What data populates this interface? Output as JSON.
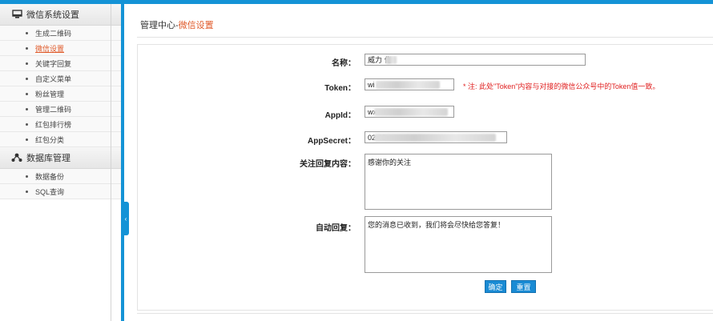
{
  "sidebar": {
    "groups": [
      {
        "title": "微信系统设置",
        "icon": "monitor-icon",
        "items": [
          {
            "label": "生成二维码"
          },
          {
            "label": "微信设置",
            "active": true
          },
          {
            "label": "关键字回复"
          },
          {
            "label": "自定义菜单"
          },
          {
            "label": "粉丝管理"
          },
          {
            "label": "管理二维码"
          },
          {
            "label": "红包排行榜"
          },
          {
            "label": "红包分类"
          }
        ]
      },
      {
        "title": "数据库管理",
        "icon": "network-icon",
        "items": [
          {
            "label": "数据备份"
          },
          {
            "label": "SQL查询"
          }
        ]
      }
    ]
  },
  "breadcrumb": {
    "home": "管理中心-",
    "current": "微信设置"
  },
  "form": {
    "name": {
      "label": "名称：",
      "value": "威力 化"
    },
    "token": {
      "label": "Token：",
      "value": "wi c",
      "note": "* 注: 此处\"Token\"内容与对接的微信公众号中的Token值一致。"
    },
    "appid": {
      "label": "AppId：",
      "value": "wx"
    },
    "appsecret": {
      "label": "AppSecret：",
      "value": "02 42"
    },
    "follow_reply": {
      "label": "关注回复内容：",
      "value": "感谢你的关注"
    },
    "auto_reply": {
      "label": "自动回复：",
      "value": "您的消息已收到，我们将会尽快给您答复！"
    },
    "confirm_label": "确定",
    "reset_label": "重置"
  },
  "colors": {
    "accent": "#1493d6",
    "active_link": "#e05a2a",
    "note": "#e02020"
  }
}
